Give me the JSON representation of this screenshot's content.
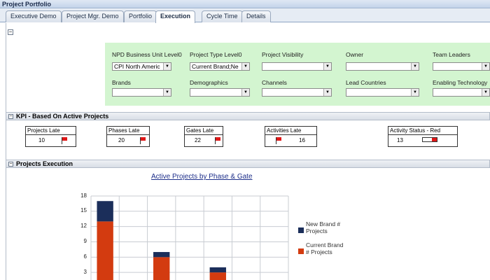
{
  "app": {
    "title": "Project Portfolio"
  },
  "tabs": [
    {
      "label": "Executive Demo",
      "active": false
    },
    {
      "label": "Project Mgr. Demo",
      "active": false
    },
    {
      "label": "Portfolio",
      "active": false
    },
    {
      "label": "Execution",
      "active": true
    },
    {
      "label": "Cycle Time",
      "active": false
    },
    {
      "label": "Details",
      "active": false
    }
  ],
  "filters": {
    "bu": {
      "label": "NPD Business Unit Level0",
      "value": "CPI North Americ"
    },
    "ptype": {
      "label": "Project Type Level0",
      "value": "Current Brand;Ne"
    },
    "visibility": {
      "label": "Project Visibility",
      "value": ""
    },
    "owner": {
      "label": "Owner",
      "value": ""
    },
    "leaders": {
      "label": "Team Leaders",
      "value": ""
    },
    "brands": {
      "label": "Brands",
      "value": ""
    },
    "demographics": {
      "label": "Demographics",
      "value": ""
    },
    "channels": {
      "label": "Channels",
      "value": ""
    },
    "lead_countries": {
      "label": "Lead Countries",
      "value": ""
    },
    "enabling_tech": {
      "label": "Enabling Technology",
      "value": ""
    }
  },
  "kpi": {
    "title": "KPI - Based On Active Projects",
    "projects_late": {
      "label": "Projects Late",
      "value": "10"
    },
    "phases_late": {
      "label": "Phases Late",
      "value": "20"
    },
    "gates_late": {
      "label": "Gates Late",
      "value": "22"
    },
    "activities_late": {
      "label": "Activities Late",
      "value": "16"
    },
    "activity_status": {
      "label": "Activity Status - Red",
      "value": "13",
      "fill_fraction": 0.35
    }
  },
  "execution": {
    "title": "Projects Execution"
  },
  "chart_data": {
    "type": "bar",
    "stacked": true,
    "title": "Active Projects by Phase & Gate",
    "yticks": [
      "18",
      "15",
      "12",
      "9",
      "6",
      "3"
    ],
    "ylim": [
      0,
      18
    ],
    "categories": [
      "",
      "",
      "",
      "",
      "",
      "",
      ""
    ],
    "series": [
      {
        "name": "New Brand # Projects",
        "color": "#1b2e5a",
        "values": [
          4,
          1,
          1,
          1,
          1,
          1,
          1
        ]
      },
      {
        "name": "Current Brand # Projects",
        "color": "#d33b10",
        "values": [
          13,
          0,
          6,
          0,
          3,
          0,
          0
        ]
      }
    ],
    "legend": [
      "New Brand # Projects",
      "Current Brand # Projects"
    ],
    "legend_position": "right",
    "grid": true
  }
}
